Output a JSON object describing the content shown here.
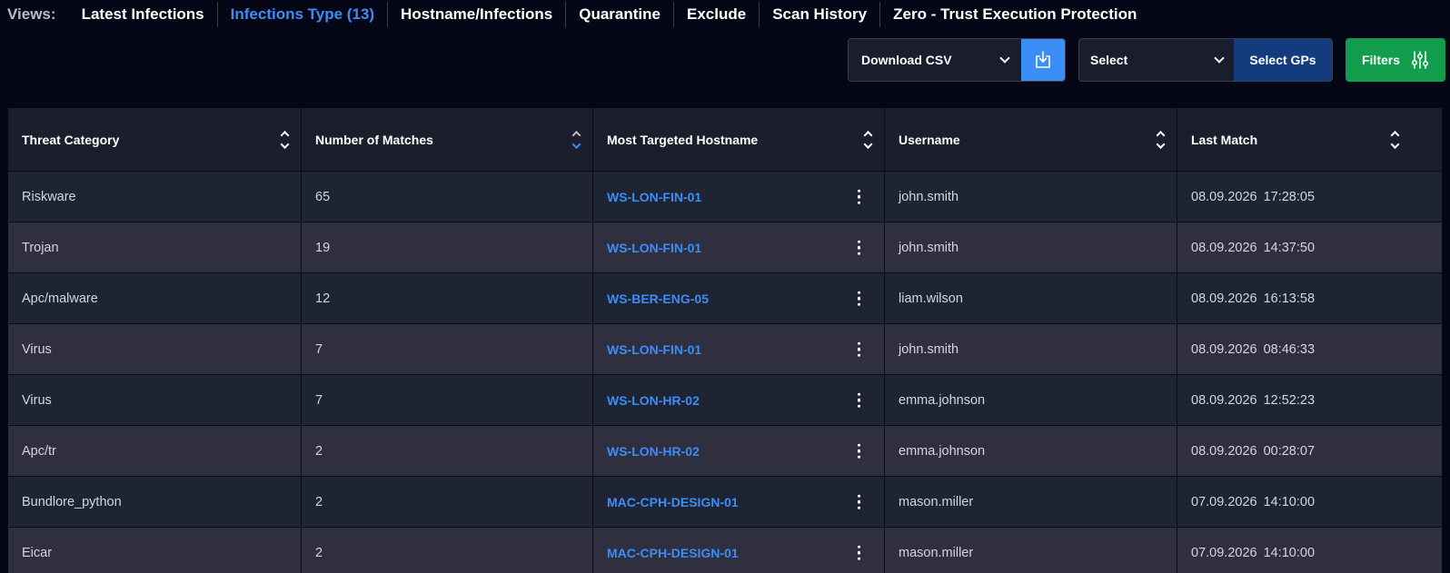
{
  "views": {
    "label": "Views:",
    "items": [
      {
        "label": "Latest Infections"
      },
      {
        "label": "Infections Type (13)"
      },
      {
        "label": "Hostname/Infections"
      },
      {
        "label": "Quarantine"
      },
      {
        "label": "Exclude"
      },
      {
        "label": "Scan History"
      },
      {
        "label": "Zero - Trust Execution Protection"
      }
    ],
    "active_index": 1
  },
  "toolbar": {
    "download_label": "Download CSV",
    "group_select_label": "Select",
    "select_gps_label": "Select GPs",
    "filters_label": "Filters"
  },
  "colors": {
    "accent": "#3b8ef5",
    "filters_green": "#119c4e",
    "select_gps_blue": "#133c7e",
    "background": "#050716"
  },
  "table": {
    "columns": [
      "Threat Category",
      "Number of Matches",
      "Most Targeted Hostname",
      "Username",
      "Last Match"
    ],
    "sorted_column": "Number of Matches",
    "sort_direction": "descending",
    "rows": [
      {
        "category": "Riskware",
        "matches": "65",
        "hostname": "WS-LON-FIN-01",
        "username": "john.smith",
        "date": "08.09.2026",
        "time": "17:28:05"
      },
      {
        "category": "Trojan",
        "matches": "19",
        "hostname": "WS-LON-FIN-01",
        "username": "john.smith",
        "date": "08.09.2026",
        "time": "14:37:50"
      },
      {
        "category": "Apc/malware",
        "matches": "12",
        "hostname": "WS-BER-ENG-05",
        "username": "liam.wilson",
        "date": "08.09.2026",
        "time": "16:13:58"
      },
      {
        "category": "Virus",
        "matches": "7",
        "hostname": "WS-LON-FIN-01",
        "username": "john.smith",
        "date": "08.09.2026",
        "time": "08:46:33"
      },
      {
        "category": "Virus",
        "matches": "7",
        "hostname": "WS-LON-HR-02",
        "username": "emma.johnson",
        "date": "08.09.2026",
        "time": "12:52:23"
      },
      {
        "category": "Apc/tr",
        "matches": "2",
        "hostname": "WS-LON-HR-02",
        "username": "emma.johnson",
        "date": "08.09.2026",
        "time": "00:28:07"
      },
      {
        "category": "Bundlore_python",
        "matches": "2",
        "hostname": "MAC-CPH-DESIGN-01",
        "username": "mason.miller",
        "date": "07.09.2026",
        "time": "14:10:00"
      },
      {
        "category": "Eicar",
        "matches": "2",
        "hostname": "MAC-CPH-DESIGN-01",
        "username": "mason.miller",
        "date": "07.09.2026",
        "time": "14:10:00"
      }
    ]
  }
}
